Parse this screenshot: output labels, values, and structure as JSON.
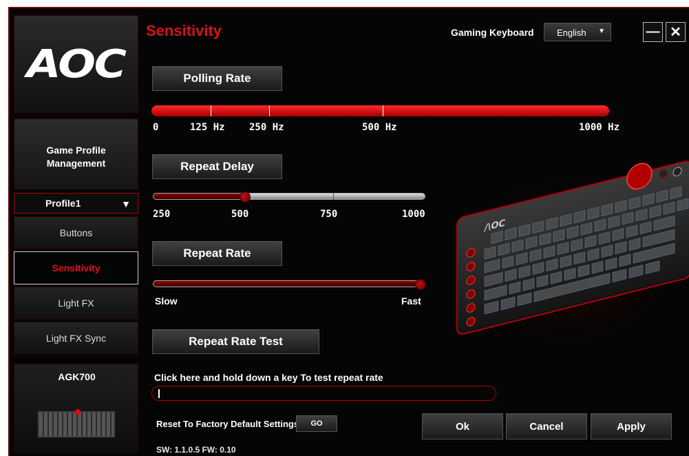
{
  "logo": "AOC",
  "sidebar": {
    "game_profile": "Game Profile Management",
    "profile": "Profile1",
    "items": [
      {
        "label": "Buttons"
      },
      {
        "label": "Sensitivity"
      },
      {
        "label": "Light FX"
      },
      {
        "label": "Light FX Sync"
      }
    ],
    "device": "AGK700"
  },
  "header": {
    "title": "Sensitivity",
    "device_label": "Gaming Keyboard",
    "language": "English",
    "minimize": "—",
    "close": "✕"
  },
  "polling_rate": {
    "label": "Polling Rate",
    "selected_hz": 1000,
    "scale": [
      "0",
      "125 Hz",
      "250 Hz",
      "500 Hz",
      "1000 Hz"
    ]
  },
  "repeat_delay": {
    "label": "Repeat Delay",
    "value": 500,
    "scale": [
      "250",
      "500",
      "750",
      "1000"
    ]
  },
  "repeat_rate": {
    "label": "Repeat Rate",
    "value_fraction": 1.0,
    "min_label": "Slow",
    "max_label": "Fast"
  },
  "repeat_rate_test": {
    "label": "Repeat Rate Test",
    "instruction": "Click here and hold down a key To test repeat rate",
    "value": ""
  },
  "reset": {
    "label": "Reset To Factory Default Settings",
    "go": "GO"
  },
  "footer": {
    "ok": "Ok",
    "cancel": "Cancel",
    "apply": "Apply",
    "version": "SW: 1.1.0.5   FW: 0.10"
  },
  "colors": {
    "accent": "#d4141a",
    "background": "#050505"
  }
}
